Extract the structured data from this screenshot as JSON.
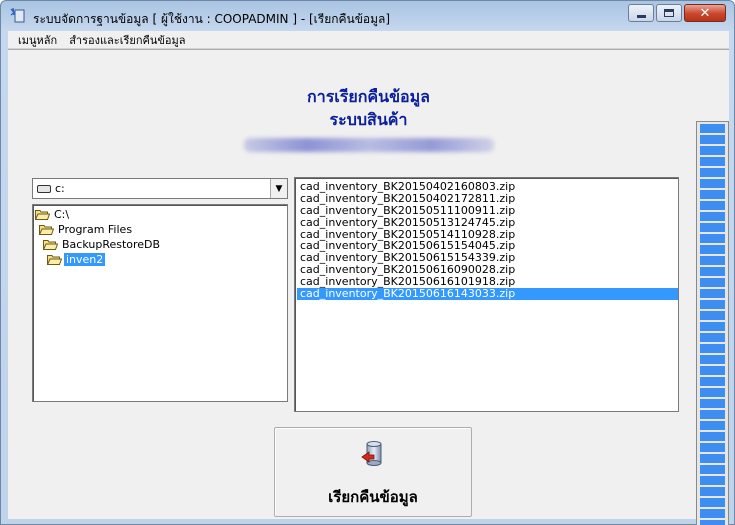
{
  "window": {
    "title": "ระบบจัดการฐานข้อมูล [ ผู้ใช้งาน : COOPADMIN ] - [เรียกคืนข้อมูล]",
    "controls": {
      "minimize_icon": "minimize-icon",
      "maximize_icon": "maximize-icon",
      "close_icon": "close-icon"
    }
  },
  "menu": {
    "items": [
      "เมนูหลัก",
      "สำรองและเรียกคืนข้อมูล"
    ]
  },
  "header": {
    "title": "การเรียกคืนข้อมูล",
    "subtitle": "ระบบสินค้า"
  },
  "drive": {
    "value": "c:"
  },
  "directories": [
    {
      "label": "C:\\",
      "icon": "folder-open-icon",
      "indent": 0,
      "selected": false
    },
    {
      "label": "Program Files",
      "icon": "folder-open-icon",
      "indent": 1,
      "selected": false
    },
    {
      "label": "BackupRestoreDB",
      "icon": "folder-open-icon",
      "indent": 2,
      "selected": false
    },
    {
      "label": "inven2",
      "icon": "folder-open-icon",
      "indent": 3,
      "selected": true
    }
  ],
  "files": [
    {
      "name": "cad_inventory_BK20150402160803.zip",
      "selected": false
    },
    {
      "name": "cad_inventory_BK20150402172811.zip",
      "selected": false
    },
    {
      "name": "cad_inventory_BK20150511100911.zip",
      "selected": false
    },
    {
      "name": "cad_inventory_BK20150513124745.zip",
      "selected": false
    },
    {
      "name": "cad_inventory_BK20150514110928.zip",
      "selected": false
    },
    {
      "name": "cad_inventory_BK20150615154045.zip",
      "selected": false
    },
    {
      "name": "cad_inventory_BK20150615154339.zip",
      "selected": false
    },
    {
      "name": "cad_inventory_BK20150616090028.zip",
      "selected": false
    },
    {
      "name": "cad_inventory_BK20150616101918.zip",
      "selected": false
    },
    {
      "name": "cad_inventory_BK20150616143033.zip",
      "selected": true
    }
  ],
  "restore_button": {
    "label": "เรียกคืนข้อมูล",
    "icon": "database-restore-icon"
  },
  "progress": {
    "fraction": 1.0
  },
  "colors": {
    "heading": "#0b1f9e",
    "selection": "#3399ff",
    "gauge": "#3d8ef0"
  }
}
